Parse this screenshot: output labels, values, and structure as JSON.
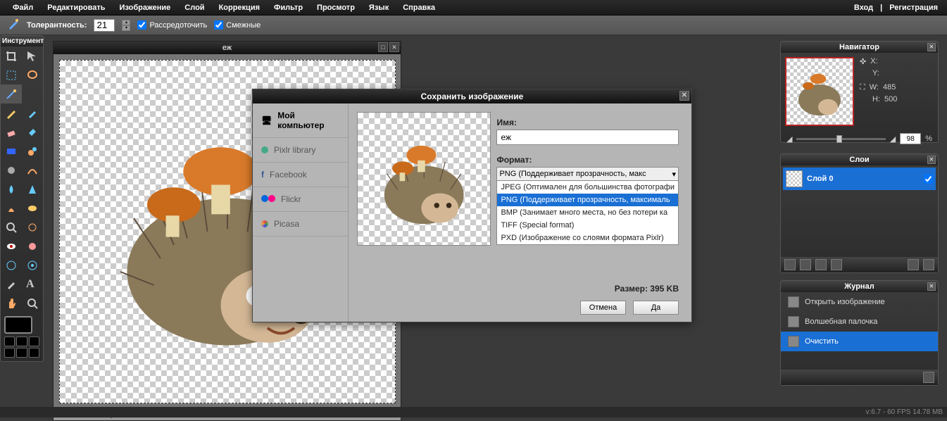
{
  "menu": {
    "items": [
      "Файл",
      "Редактировать",
      "Изображение",
      "Слой",
      "Коррекция",
      "Фильтр",
      "Просмотр",
      "Язык",
      "Справка"
    ],
    "login": "Вход",
    "sep": "|",
    "register": "Регистрация"
  },
  "options": {
    "tolerance_label": "Толерантность:",
    "tolerance_value": "21",
    "scatter_label": "Рассредоточить",
    "adjacent_label": "Смежные"
  },
  "tools": {
    "title": "Инструмент"
  },
  "canvas": {
    "title": "еж",
    "zoom": "98",
    "zoom_pct": "%",
    "dims": "485x500 px"
  },
  "dialog": {
    "title": "Сохранить изображение",
    "destinations": [
      "Мой компьютер",
      "Pixlr library",
      "Facebook",
      "Flickr",
      "Picasa"
    ],
    "name_label": "Имя:",
    "name_value": "еж",
    "format_label": "Формат:",
    "format_selected": "PNG (Поддерживает прозрачность, макс",
    "format_options": [
      "JPEG (Оптимален для большинства фотографи",
      "PNG (Поддерживает прозрачность, максималь",
      "BMP (Занимает много места, но без потери ка",
      "TIFF (Special format)",
      "PXD (Изображение со слоями формата Pixlr)"
    ],
    "format_selected_index": 1,
    "size_label": "Размер: 395 KB",
    "cancel": "Отмена",
    "ok": "Да"
  },
  "navigator": {
    "title": "Навигатор",
    "x_label": "X:",
    "y_label": "Y:",
    "w_label": "W:",
    "h_label": "H:",
    "w_val": "485",
    "h_val": "500",
    "zoom": "98",
    "pct": "%"
  },
  "layers": {
    "title": "Слои",
    "layer0": "Слой 0"
  },
  "history": {
    "title": "Журнал",
    "items": [
      "Открыть изображение",
      "Волшебная палочка",
      "Очистить"
    ],
    "selected_index": 2
  },
  "footer": {
    "text": "v:6.7 - 60 FPS 14.78 MB"
  }
}
